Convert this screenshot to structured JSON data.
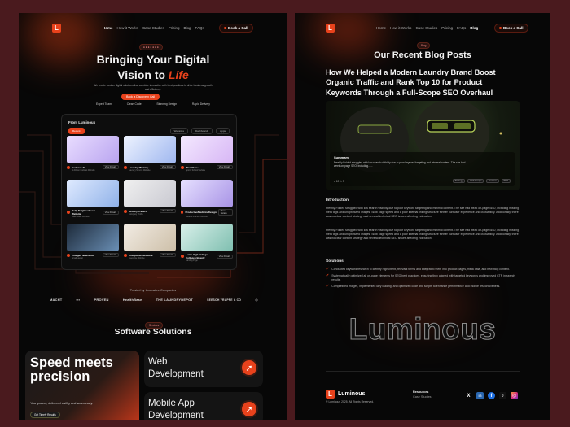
{
  "nav": {
    "links_left": [
      "Home",
      "How it Works",
      "Case Studies",
      "Pricing",
      "Blog",
      "FAQs"
    ],
    "links_right": [
      "Home",
      "How it Works",
      "Case Studies",
      "Pricing",
      "FAQs",
      "Blog"
    ],
    "cta": "Book a Call"
  },
  "hero": {
    "pill": "● ● ● ● ● ● ●",
    "title_line1": "Bringing Your Digital",
    "title_line2": "Vision to",
    "title_accent": "Life",
    "subtitle": "We create custom digital solutions that combine innovation with best practices to drive business growth and efficiency.",
    "cta": "Book a Discovery Call",
    "tags": [
      "Expert Team",
      "Clean Code",
      "Stunning Design",
      "Rapid Delivery"
    ]
  },
  "projects": {
    "heading": "From Luminous",
    "filters": [
      "Recent",
      "Websites",
      "Dashboards",
      "Apps"
    ],
    "cards": [
      {
        "title": "Cadence AI",
        "sub": "AI-Driven Podcast Website",
        "btn": "View Details"
      },
      {
        "title": "Laundry Ministry",
        "sub": "Laundry Service Website",
        "btn": "View Details"
      },
      {
        "title": "WorkFlow+",
        "sub": "Sports School Website",
        "btn": "View Details"
      },
      {
        "title": "Daily Neighborhood Website",
        "sub": "Real Estate Website",
        "btn": "View Details"
      },
      {
        "title": "Destiny Traders",
        "sub": "Company Profile",
        "btn": "View Details"
      },
      {
        "title": "ProductiveMedicineDesign",
        "sub": "Medical Practice Website",
        "btn": "View Details"
      },
      {
        "title": "Charged Newsletter",
        "sub": "Email Layout",
        "btn": "View Details"
      },
      {
        "title": "Emmpasseexecutive",
        "sub": "Executive Website",
        "btn": "View Details"
      },
      {
        "title": "Lume High Voltage Collagen Beauty",
        "sub": "Landing Page",
        "btn": "View Details"
      }
    ]
  },
  "trusted": {
    "label": "Trusted by Innovative Companies",
    "logos": [
      "MACHT",
      "▪▪▪",
      "PROVEN",
      "HealthBase",
      "THE LAUNDRYDEPOT",
      "SEESOH YRAPPE & CO",
      "◎"
    ]
  },
  "services": {
    "pill": "Services",
    "title": "Software Solutions",
    "speed_title": "Speed meets precision",
    "speed_desc": "Your project, delivered swiftly and seamlessly.",
    "speed_btn": "Get Timely Results",
    "items": [
      "Web Development",
      "Mobile App Development"
    ]
  },
  "blog": {
    "pill": "Blog",
    "title": "Our Recent Blog Posts",
    "post_title": "How We Helped a Modern Laundry Brand Boost Organic Traffic and Rank Top 10 for Product Keywords Through a Full-Scope SEO Overhaul",
    "summary_heading": "Summary",
    "summary_text": "Freshly Folded struggled with low search visibility due to poor keyword targeting and minimal content. The site had week-on-page SEO, including......",
    "summary_stats": "♥ 12  ✎ 3",
    "summary_tags": [
      "Strategy",
      "Web Design",
      "Content",
      "SEO"
    ],
    "intro_heading": "Introduction",
    "intro_p1": "Freshly Folded struggled with low search visibility due to poor keyword targeting and minimal content. The site had weak on-page SEO, including missing meta tags and unoptimized images. Slow page speed and a poor internal linking structure further hurt user experience and crawlability. Additionally, there was no clear content strategy and several technical SEO issues affecting indexation.",
    "intro_p2": "Freshly Folded struggled with low search visibility due to poor keyword targeting and minimal content. The site had weak on-page SEO, including missing meta tags and unoptimized images. Slow page speed and a poor internal linking structure further hurt user experience and crawlability. Additionally, there was no clear content strategy and several technical SEO issues affecting indexation.",
    "solutions_heading": "Solutions",
    "solutions": [
      "Conducted keyword research to identify high-intent, relevant terms and integrated them into product pages, meta data, and new blog content.",
      "Systematically optimized all on-page elements for SEO best practices, ensuring they aligned with targeted keywords and improved CTR in search results.",
      "Compressed images, implemented lazy loading, and optimized code and scripts to enhance performance and mobile responsiveness."
    ]
  },
  "footer": {
    "wordmark": "Luminous",
    "brand": "Luminous",
    "copyright": "© Luminous 2025. All Rights Reserved.",
    "col_heading": "Resources",
    "col_link": "Case Studies",
    "socials": [
      "X",
      "in",
      "f",
      "♪",
      "◎"
    ]
  },
  "colors": {
    "accent": "#e8421c",
    "bg": "#070707",
    "frame": "#4a1a1e"
  }
}
